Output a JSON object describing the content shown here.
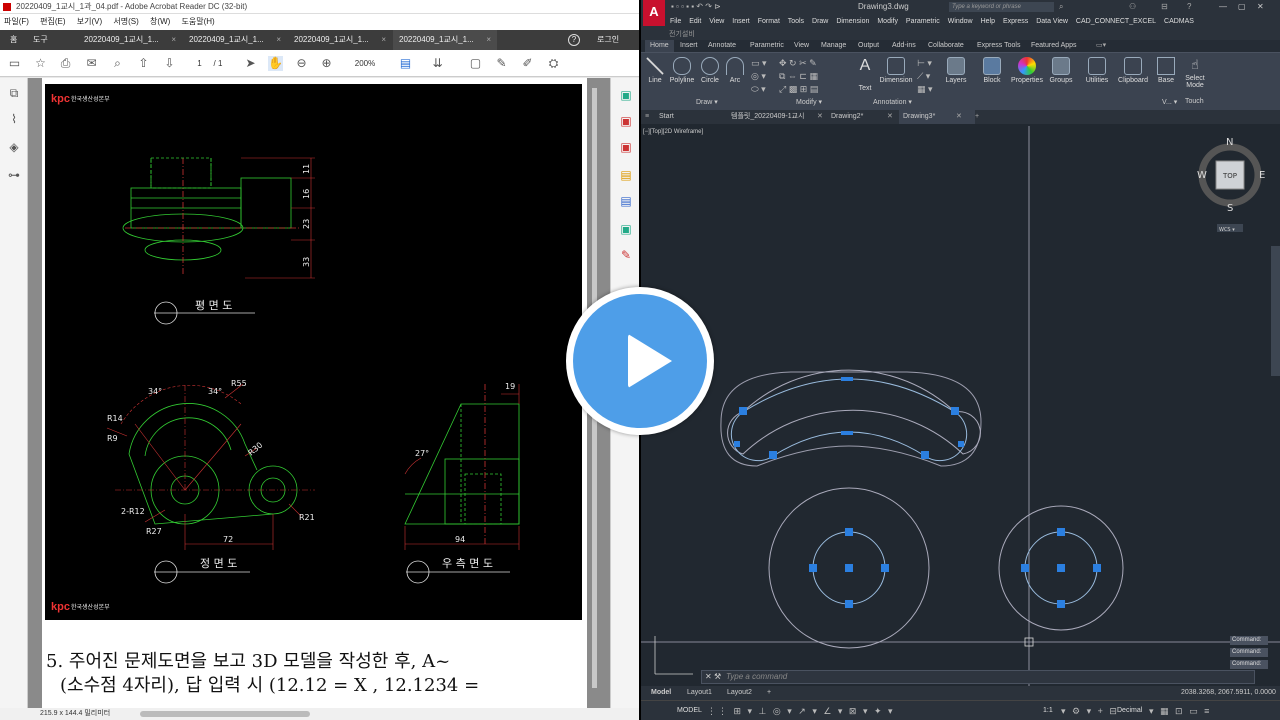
{
  "acrobat": {
    "title": "20220409_1교시_1과_04.pdf - Adobe Acrobat Reader DC (32-bit)",
    "menu": [
      "파일(F)",
      "편집(E)",
      "보기(V)",
      "서명(S)",
      "창(W)",
      "도움말(H)"
    ],
    "nav": {
      "home": "홈",
      "tools": "도구",
      "help": "?",
      "login": "로그인"
    },
    "tabs": [
      "20220409_1교시_1...",
      "20220409_1교시_1...",
      "20220409_1교시_1...",
      "20220409_1교시_1..."
    ],
    "tab_close": "×",
    "page_current": "1",
    "page_total": "/ 1",
    "zoom": "200%",
    "status": "215.9 x 144.4 밀리미터",
    "question_line1": "5. 주어진 문제도면을 보고 3D 모델을 작성한 후, A~",
    "question_line2": "(소수점 4자리), 답 입력 시 (12.12 = X , 12.1234 ="
  },
  "drawing": {
    "logo": "kpc",
    "org": "한국생산성본부",
    "dims_top": [
      "11",
      "16",
      "23",
      "33"
    ],
    "label_plan": "평 면 도",
    "label_front": "정 면 도",
    "label_side": "우 측 면 도",
    "front_dims": [
      "34°",
      "34°",
      "R55",
      "R14",
      "R9",
      "R30",
      "2-R12",
      "R27",
      "R21",
      "72"
    ],
    "side_dims": [
      "19",
      "27°",
      "94"
    ]
  },
  "autocad": {
    "file_title": "Drawing3.dwg",
    "search_placeholder": "Type a keyword or phrase",
    "menu": [
      "File",
      "Edit",
      "View",
      "Insert",
      "Format",
      "Tools",
      "Draw",
      "Dimension",
      "Modify",
      "Parametric",
      "Window",
      "Help",
      "Express",
      "Data View",
      "CAD_CONNECT_EXCEL",
      "CADMAS"
    ],
    "submenu": "전기설비",
    "ribbon_tabs": [
      "Home",
      "Insert",
      "Annotate",
      "Parametric",
      "View",
      "Manage",
      "Output",
      "Add-ins",
      "Collaborate",
      "Express Tools",
      "Featured Apps"
    ],
    "draw_tools": [
      "Line",
      "Polyline",
      "Circle",
      "Arc"
    ],
    "annotation_tools": [
      "Text",
      "Dimension"
    ],
    "panel_tools": [
      "Layers",
      "Block",
      "Properties",
      "Groups",
      "Utilities",
      "Clipboard",
      "Base"
    ],
    "select_mode": "Select Mode",
    "touch": "Touch",
    "groups": [
      "Draw ▾",
      "Modify ▾",
      "Annotation ▾",
      "V... ▾"
    ],
    "doc_tabs": [
      "Start",
      "템플릿_20220409-1교시",
      "Drawing2*",
      "Drawing3*"
    ],
    "viewport_label": "[−][Top][2D Wireframe]",
    "compass": {
      "n": "N",
      "s": "S",
      "e": "E",
      "w": "W",
      "top": "TOP",
      "wcs": "WCS ▾"
    },
    "command_history": [
      "Command:",
      "Command:",
      "Command:"
    ],
    "command_placeholder": "Type a command",
    "layouts": [
      "Model",
      "Layout1",
      "Layout2"
    ],
    "coords": "2038.3268, 2067.5911, 0.0000",
    "status_model": "MODEL",
    "status_scale": "1:1",
    "status_units": "Decimal"
  }
}
